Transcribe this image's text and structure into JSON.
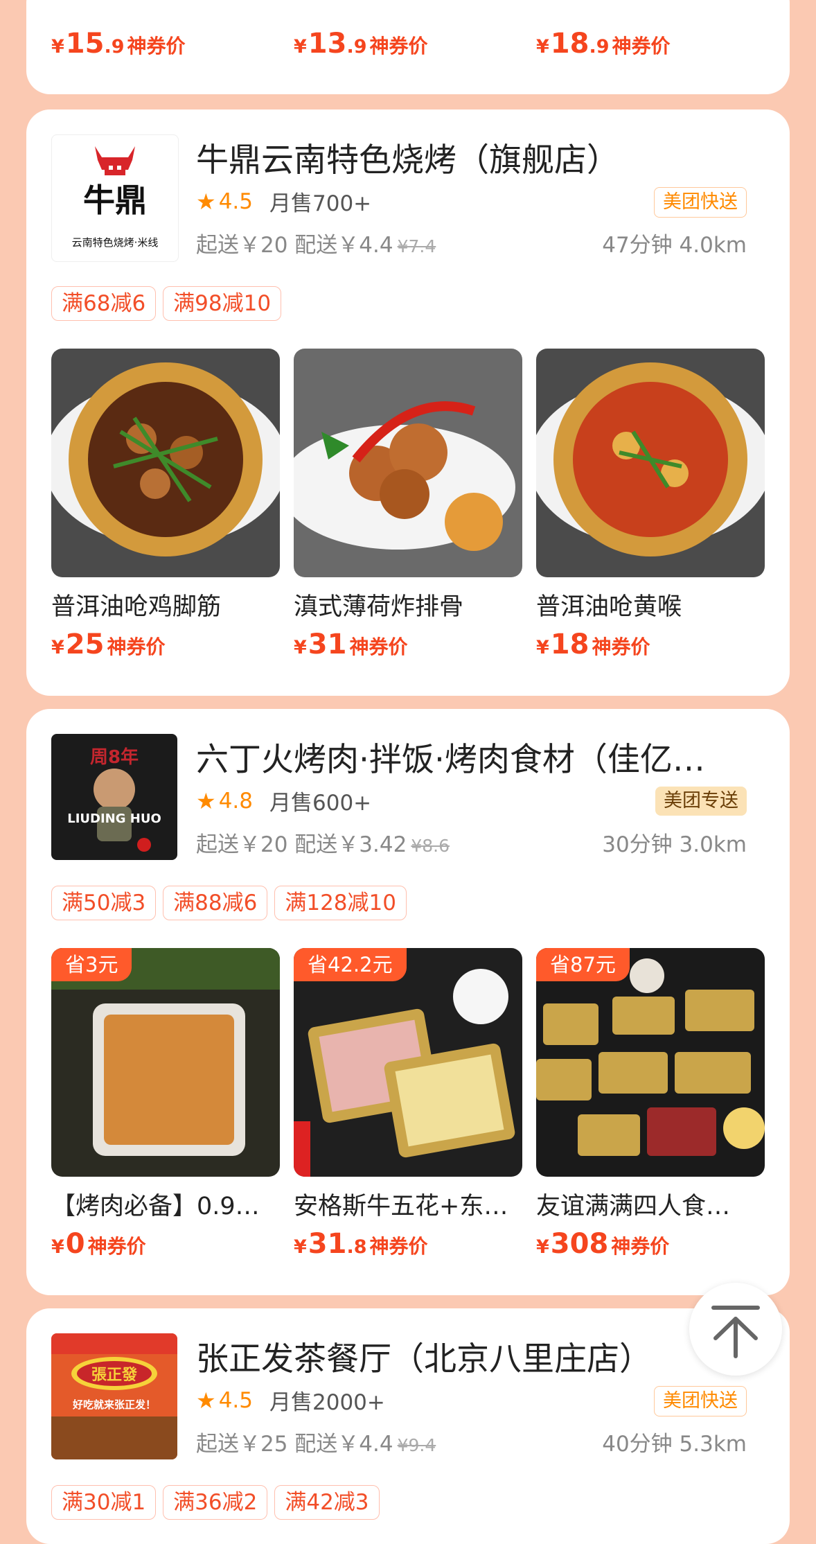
{
  "top_prices": [
    {
      "int": "15",
      "dec": ".9",
      "tag": "神券价"
    },
    {
      "int": "13",
      "dec": ".9",
      "tag": "神券价"
    },
    {
      "int": "18",
      "dec": ".9",
      "tag": "神券价"
    }
  ],
  "currency": "¥",
  "stores": [
    {
      "name": "牛鼎云南特色烧烤（旗舰店）",
      "logo_text": "牛鼎",
      "logo_sub": "云南特色烧烤·米线",
      "rating": "4.5",
      "sales": "月售700+",
      "badge": "美团快送",
      "fee": "起送￥20 配送￥4.4",
      "fee_orig": "¥7.4",
      "distance": "47分钟 4.0km",
      "coupons": [
        "满68减6",
        "满98减10"
      ],
      "dishes": [
        {
          "name": "普洱油呛鸡脚筋",
          "price_int": "25",
          "price_dec": "",
          "tag": "神券价",
          "save": ""
        },
        {
          "name": "滇式薄荷炸排骨",
          "price_int": "31",
          "price_dec": "",
          "tag": "神券价",
          "save": ""
        },
        {
          "name": "普洱油呛黄喉",
          "price_int": "18",
          "price_dec": "",
          "tag": "神券价",
          "save": ""
        }
      ]
    },
    {
      "name": "六丁火烤肉·拌饭·烤肉食材（佳亿…",
      "logo_text": "LIUDING HUO",
      "logo_sub": "周8年",
      "rating": "4.8",
      "sales": "月售600+",
      "badge": "美团专送",
      "fee": "起送￥20 配送￥3.42",
      "fee_orig": "¥8.6",
      "distance": "30分钟 3.0km",
      "coupons": [
        "满50减3",
        "满88减6",
        "满128减10"
      ],
      "dishes": [
        {
          "name": "【烤肉必备】0.9…",
          "price_int": "0",
          "price_dec": "",
          "tag": "神券价",
          "save": "省3元"
        },
        {
          "name": "安格斯牛五花+东…",
          "price_int": "31",
          "price_dec": ".8",
          "tag": "神券价",
          "save": "省42.2元"
        },
        {
          "name": "友谊满满四人食…",
          "price_int": "308",
          "price_dec": "",
          "tag": "神券价",
          "save": "省87元"
        }
      ]
    },
    {
      "name": "张正发茶餐厅（北京八里庄店）",
      "logo_text": "張正發",
      "logo_sub": "好吃就来张正发！",
      "rating": "4.5",
      "sales": "月售2000+",
      "badge": "美团快送",
      "fee": "起送￥25 配送￥4.4",
      "fee_orig": "¥9.4",
      "distance": "40分钟 5.3km",
      "coupons": [
        "满30减1",
        "满36减2",
        "满42减3"
      ]
    }
  ],
  "icons": {
    "star": "star-icon",
    "back_to_top": "arrow-up-to-top-icon"
  },
  "colors": {
    "accent": "#f5451e",
    "background": "#fbc9b2",
    "rating": "#ff8a00"
  }
}
